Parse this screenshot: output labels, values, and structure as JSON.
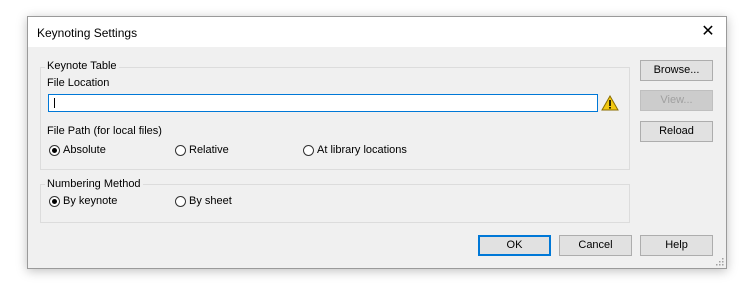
{
  "window": {
    "title": "Keynoting Settings"
  },
  "keynote_table": {
    "legend": "Keynote Table",
    "file_location_label": "File Location",
    "file_location_value": "",
    "file_path_label": "File Path (for local files)",
    "path_options": [
      {
        "label": "Absolute",
        "selected": true
      },
      {
        "label": "Relative",
        "selected": false
      },
      {
        "label": "At library locations",
        "selected": false
      }
    ]
  },
  "numbering": {
    "legend": "Numbering Method",
    "options": [
      {
        "label": "By keynote",
        "selected": true
      },
      {
        "label": "By sheet",
        "selected": false
      }
    ]
  },
  "side_buttons": {
    "browse": "Browse...",
    "view": "View...",
    "reload": "Reload"
  },
  "footer_buttons": {
    "ok": "OK",
    "cancel": "Cancel",
    "help": "Help"
  },
  "colors": {
    "accent": "#0078d7",
    "warning": "#f2c811"
  }
}
